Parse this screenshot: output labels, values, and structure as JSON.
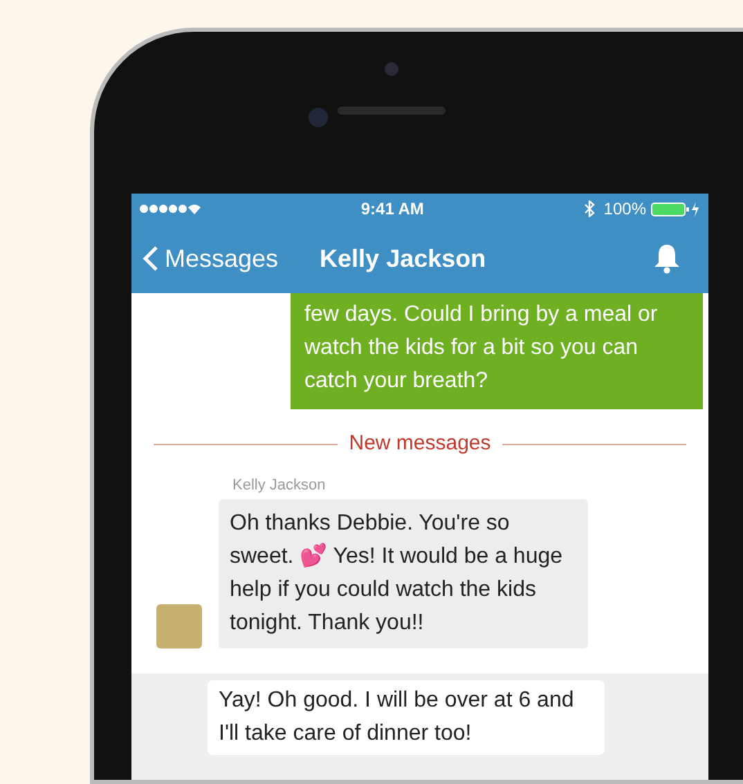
{
  "status_bar": {
    "time": "9:41 AM",
    "battery": "100%"
  },
  "nav_bar": {
    "back": "Messages",
    "title": "Kelly Jackson"
  },
  "messages": [
    {
      "kind": "outgoing",
      "text": "few days. Could I bring by a meal or watch the kids for a bit so you can catch your breath?"
    },
    {
      "kind": "divider",
      "text": "New messages"
    },
    {
      "kind": "incoming",
      "sender": "Kelly Jackson",
      "text": "Oh thanks Debbie. You're so sweet. 💕 Yes! It would be a huge help if you could watch the kids tonight. Thank you!!"
    }
  ],
  "composer": {
    "value": "Yay! Oh good. I will be over at 6 and I'll take care of dinner too!"
  }
}
